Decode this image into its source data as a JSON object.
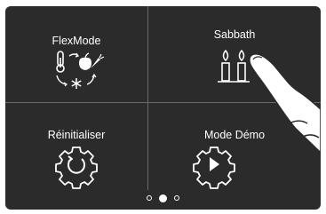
{
  "tiles": {
    "flexmode": {
      "label": "FlexMode",
      "icon": "fridge-freezer-convert-icon"
    },
    "sabbath": {
      "label": "Sabbath",
      "icon": "candles-icon"
    },
    "reset": {
      "label": "Réinitialiser",
      "icon": "gear-reset-icon"
    },
    "demo": {
      "label": "Mode Démo",
      "icon": "gear-play-icon"
    }
  },
  "pager": {
    "pages": 3,
    "current_page": 2
  },
  "colors": {
    "background": "#2b2b2b",
    "foreground": "#ffffff",
    "divider": "#6a6a6a"
  }
}
